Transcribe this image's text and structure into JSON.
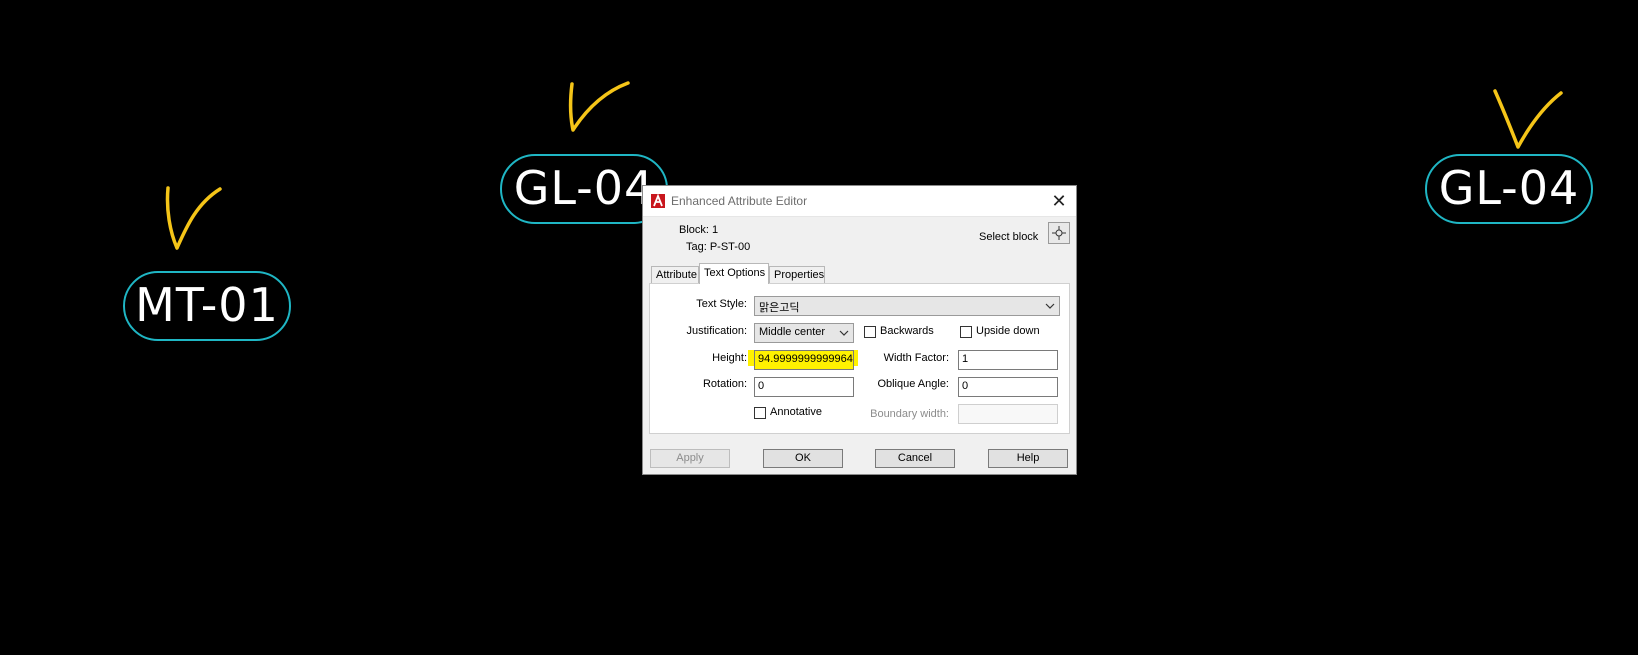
{
  "canvas": {
    "bubbles": [
      {
        "label": "MT-01"
      },
      {
        "label": "GL-04"
      },
      {
        "label": "GL-04"
      }
    ]
  },
  "dialog": {
    "title": "Enhanced Attribute Editor",
    "block_label": "Block: 1",
    "tag_label": "Tag: P-ST-00",
    "select_block_label": "Select block",
    "tabs": [
      {
        "label": "Attribute"
      },
      {
        "label": "Text Options"
      },
      {
        "label": "Properties"
      }
    ],
    "text_style": {
      "label": "Text Style:",
      "value": "맑은고딕"
    },
    "justification": {
      "label": "Justification:",
      "value": "Middle center"
    },
    "backwards": {
      "label": "Backwards",
      "checked": false
    },
    "upside_down": {
      "label": "Upside down",
      "checked": false
    },
    "height": {
      "label": "Height:",
      "value": "94.9999999999964"
    },
    "width_factor": {
      "label": "Width Factor:",
      "value": "1"
    },
    "rotation": {
      "label": "Rotation:",
      "value": "0"
    },
    "oblique_angle": {
      "label": "Oblique Angle:",
      "value": "0"
    },
    "annotative": {
      "label": "Annotative",
      "checked": false
    },
    "boundary_width": {
      "label": "Boundary width:",
      "value": ""
    },
    "buttons": {
      "apply": "Apply",
      "ok": "OK",
      "cancel": "Cancel",
      "help": "Help"
    }
  },
  "colors": {
    "background": "#000000",
    "bubble_outline": "#1fb6c4",
    "check_mark": "#f5c518",
    "highlight": "#fff200",
    "app_icon": "#c8161d"
  }
}
